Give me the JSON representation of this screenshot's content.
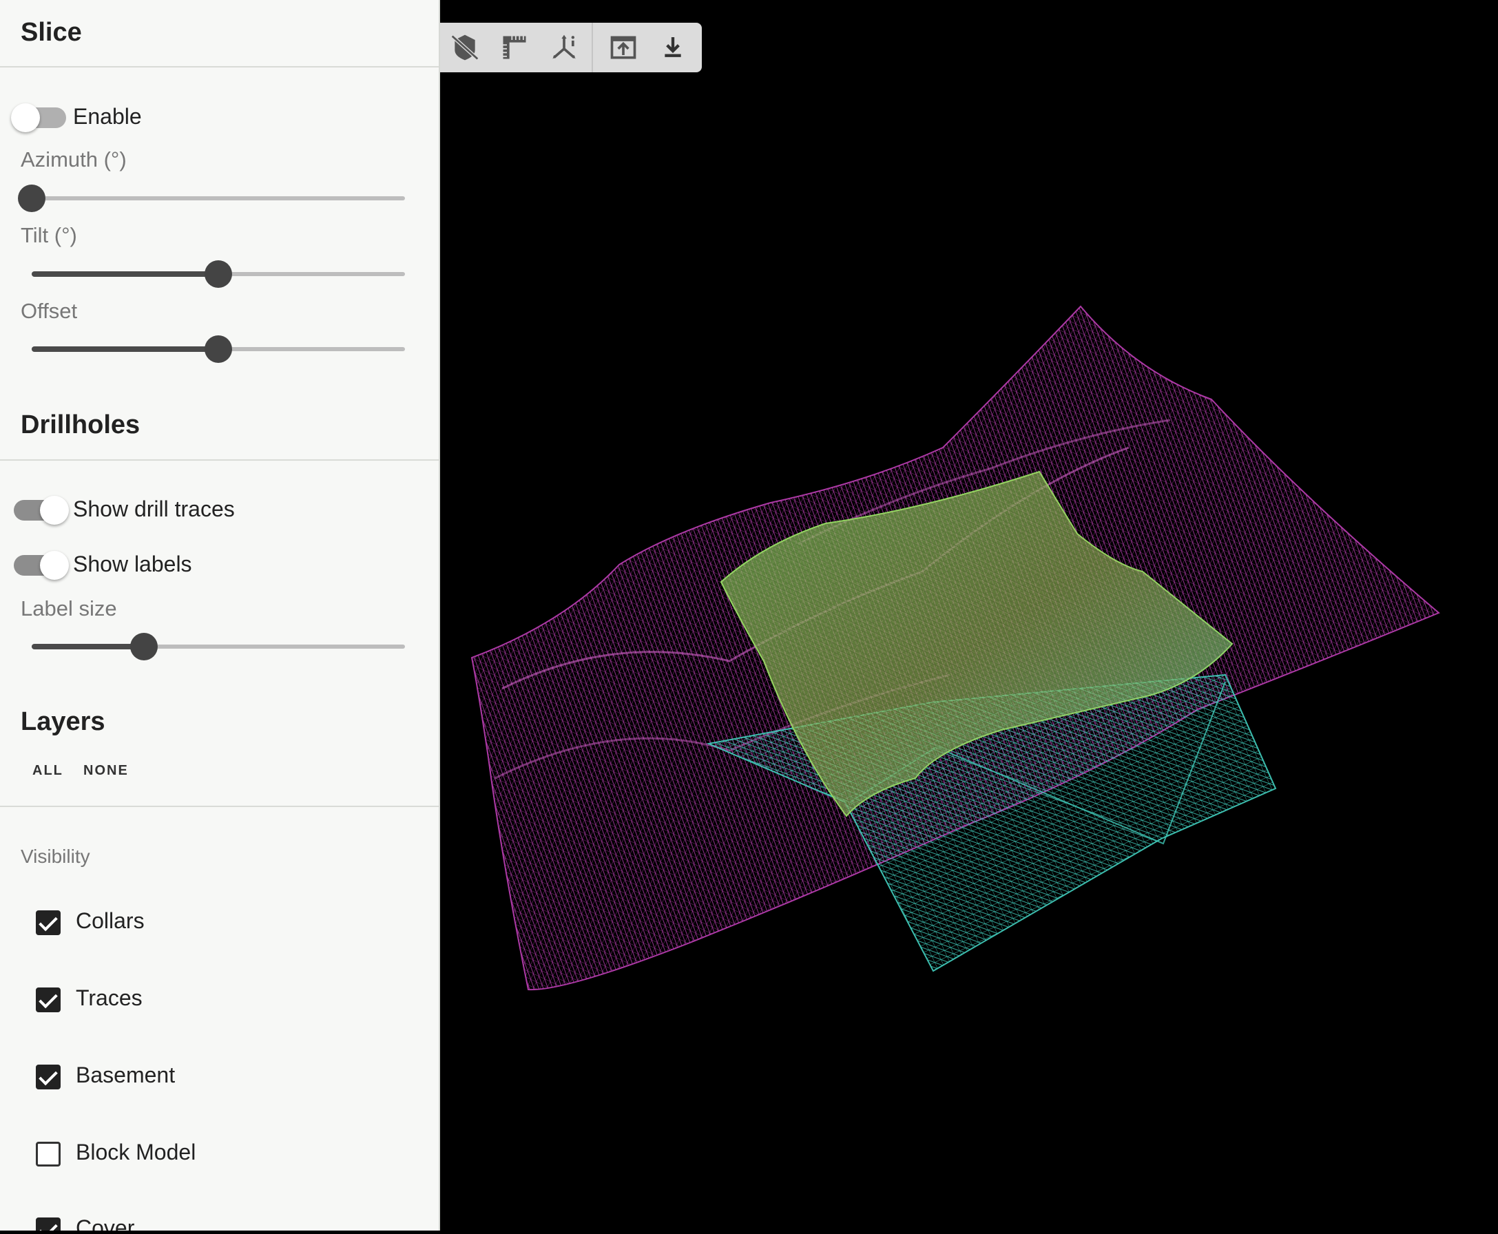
{
  "slice": {
    "title": "Slice",
    "enable_label": "Enable",
    "enable_on": false,
    "azimuth_label": "Azimuth (°)",
    "azimuth_fraction": 0.0,
    "tilt_label": "Tilt (°)",
    "tilt_fraction": 0.5,
    "offset_label": "Offset",
    "offset_fraction": 0.5
  },
  "drillholes": {
    "title": "Drillholes",
    "show_traces_label": "Show drill traces",
    "show_traces_on": true,
    "show_labels_label": "Show labels",
    "show_labels_on": true,
    "label_size_label": "Label size",
    "label_size_fraction": 0.3
  },
  "layers": {
    "title": "Layers",
    "all_label": "ALL",
    "none_label": "NONE",
    "visibility_label": "Visibility",
    "items": [
      {
        "label": "Collars",
        "checked": true
      },
      {
        "label": "Traces",
        "checked": true
      },
      {
        "label": "Basement",
        "checked": true
      },
      {
        "label": "Block Model",
        "checked": false
      },
      {
        "label": "Cover",
        "checked": true
      }
    ]
  },
  "toolbar": {
    "icons": [
      "hide-object-icon",
      "ruler-icon",
      "axes-info-icon",
      "upload-icon",
      "download-icon"
    ]
  },
  "colors": {
    "background": "#000000",
    "cover_mesh": "#c040b8",
    "basement_mesh": "#8fd860",
    "block_mesh": "#40c8b8"
  }
}
